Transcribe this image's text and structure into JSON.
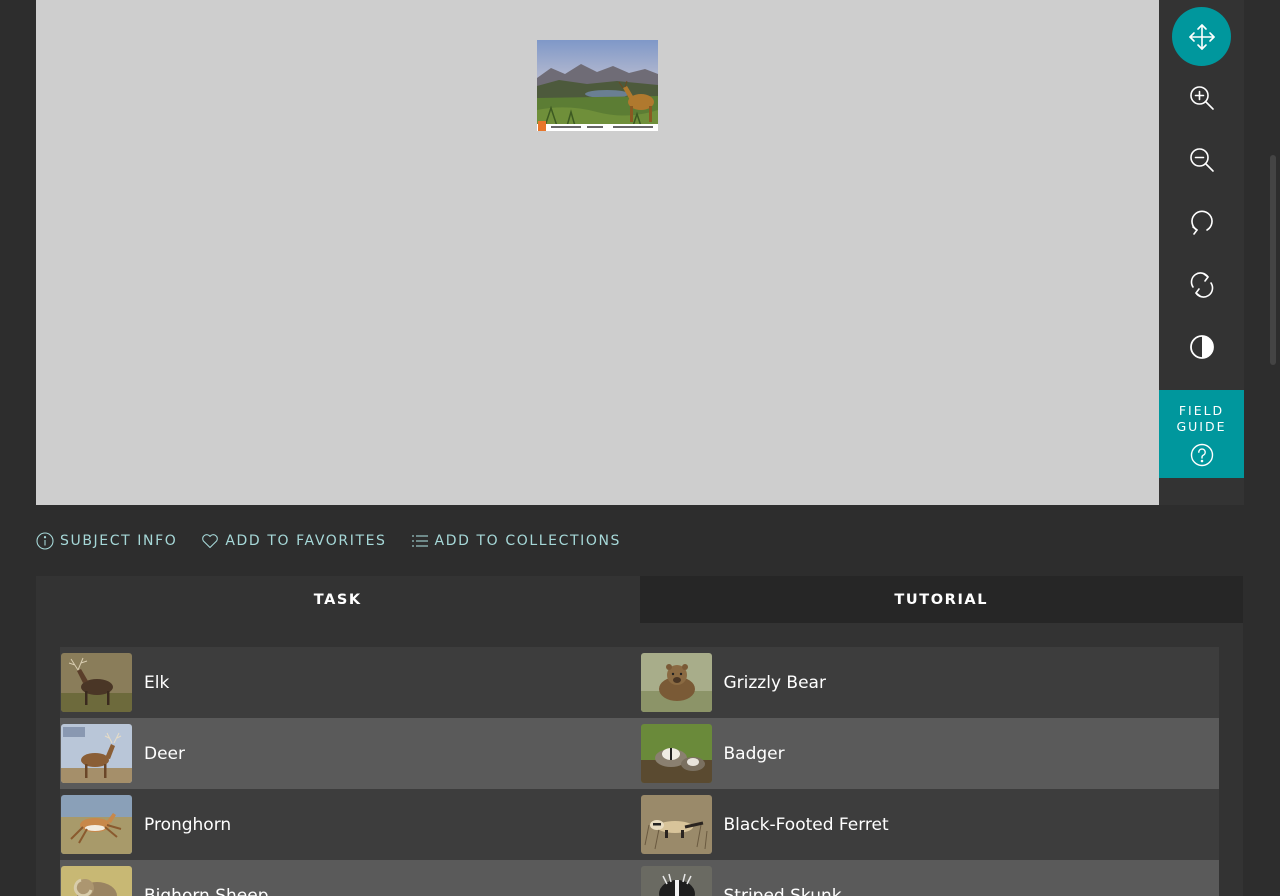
{
  "viewer": {
    "subject_alt": "camera trap photo",
    "colors": {
      "background": "#cecece"
    }
  },
  "toolbar": {
    "tools": [
      {
        "name": "move-icon",
        "active": true
      },
      {
        "name": "zoom-in-icon",
        "active": false
      },
      {
        "name": "zoom-out-icon",
        "active": false
      },
      {
        "name": "rotate-icon",
        "active": false
      },
      {
        "name": "reset-icon",
        "active": false
      },
      {
        "name": "invert-icon",
        "active": false
      }
    ],
    "field_guide_label": "FIELD GUIDE",
    "field_guide_icon": "question-circle-icon",
    "colors": {
      "accent": "#00979d",
      "panel": "#333333"
    }
  },
  "meta_bar": {
    "subject_info": "SUBJECT INFO",
    "add_to_favorites": "ADD TO FAVORITES",
    "add_to_collections": "ADD TO COLLECTIONS",
    "colors": {
      "text": "#a6d8d8"
    }
  },
  "tabs": [
    {
      "label": "TASK",
      "active": true
    },
    {
      "label": "TUTORIAL",
      "active": false
    }
  ],
  "choices": [
    {
      "label": "Elk",
      "thumb": "elk"
    },
    {
      "label": "Grizzly Bear",
      "thumb": "grizzly-bear"
    },
    {
      "label": "Deer",
      "thumb": "deer"
    },
    {
      "label": "Badger",
      "thumb": "badger"
    },
    {
      "label": "Pronghorn",
      "thumb": "pronghorn"
    },
    {
      "label": "Black-Footed Ferret",
      "thumb": "black-footed-ferret"
    },
    {
      "label": "Bighorn Sheep",
      "thumb": "bighorn-sheep"
    },
    {
      "label": "Striped Skunk",
      "thumb": "striped-skunk"
    }
  ]
}
